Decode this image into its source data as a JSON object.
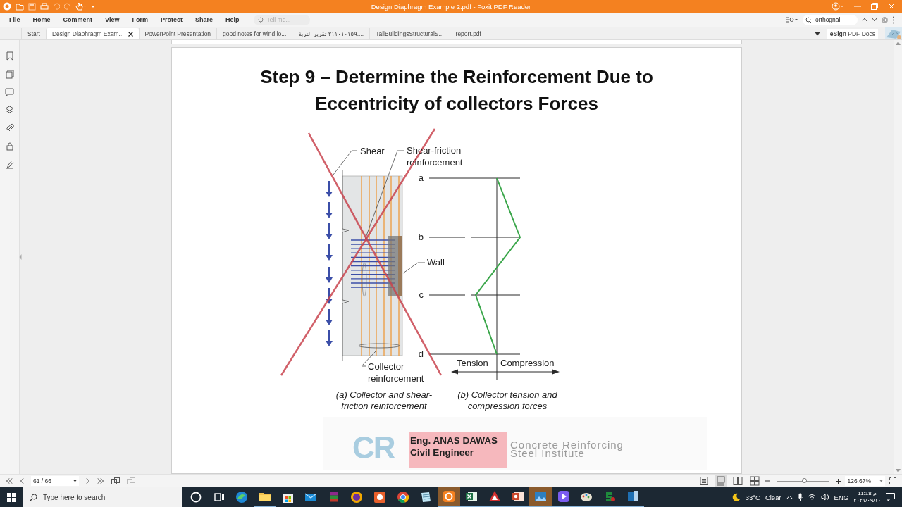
{
  "title_bar": {
    "title": "Design Diaphragm Example 2.pdf - Foxit PDF Reader"
  },
  "menu": [
    "File",
    "Home",
    "Comment",
    "View",
    "Form",
    "Protect",
    "Share",
    "Help"
  ],
  "tell_me": {
    "placeholder": "Tell me..."
  },
  "find": {
    "value": "orthognal"
  },
  "doc_tabs": [
    {
      "label": "Start",
      "selected": false
    },
    {
      "label": "Design Diaphragm Exam...",
      "selected": true
    },
    {
      "label": "PowerPoint Presentation",
      "selected": false
    },
    {
      "label": "good notes for wind lo...",
      "selected": false
    },
    {
      "label": "٢١١٠١٠١٥٩ تقرير التربة....",
      "selected": false
    },
    {
      "label": "TallBuildingsStructuralS...",
      "selected": false
    },
    {
      "label": "report.pdf",
      "selected": false
    }
  ],
  "esign": "**eSign** PDF Docs",
  "slide": {
    "title": "Step 9 – Determine the Reinforcement Due to Eccentricity of collectors Forces",
    "figure": {
      "labels": [
        {
          "lines": [
            "Shear"
          ]
        },
        {
          "lines": [
            "Shear-friction",
            "reinforcement"
          ]
        },
        {
          "lines": [
            "a"
          ]
        },
        {
          "lines": [
            "b"
          ]
        },
        {
          "lines": [
            "Wall"
          ]
        },
        {
          "lines": [
            "c"
          ]
        },
        {
          "lines": [
            "d"
          ]
        },
        {
          "lines": [
            "Collector",
            "reinforcement"
          ]
        },
        {
          "lines": [
            "Tension"
          ]
        },
        {
          "lines": [
            "Compression"
          ]
        }
      ],
      "captions": [
        {
          "lines": [
            "(a) Collector and shear-",
            "friction reinforcement"
          ]
        },
        {
          "lines": [
            "(b) Collector tension and",
            "compression forces"
          ]
        }
      ]
    },
    "credit": [
      "Eng. ANAS DAWAS",
      "Civil Engineer"
    ],
    "logo": {
      "mark": "CR",
      "lines": [
        "Concrete Reinforcing",
        "Steel Institute"
      ]
    }
  },
  "status_bar": {
    "page": "61 / 66",
    "view_modes": [
      {
        "kind": "single",
        "selected": false
      },
      {
        "kind": "continuous",
        "selected": true
      },
      {
        "kind": "facing",
        "selected": false
      },
      {
        "kind": "continuous-facing",
        "selected": false
      }
    ],
    "zoom_slider": {
      "level": 0.54
    },
    "zoom": "126.67%"
  },
  "taskbar": {
    "search_placeholder": "Type here to search",
    "apps": [
      {
        "kind": "cortana",
        "running": false,
        "selected": false
      },
      {
        "kind": "task-view",
        "running": false,
        "selected": false
      },
      {
        "kind": "edge",
        "running": false,
        "selected": false
      },
      {
        "kind": "folder",
        "running": true,
        "selected": false
      },
      {
        "kind": "store",
        "running": false,
        "selected": false
      },
      {
        "kind": "mail",
        "running": false,
        "selected": false
      },
      {
        "kind": "archive",
        "running": false,
        "selected": false
      },
      {
        "kind": "shield",
        "running": false,
        "selected": false
      },
      {
        "kind": "orange-app",
        "running": false,
        "selected": false
      },
      {
        "kind": "chrome",
        "running": false,
        "selected": false
      },
      {
        "kind": "notepad",
        "running": false,
        "selected": false
      },
      {
        "kind": "foxit",
        "running": true,
        "selected": true
      },
      {
        "kind": "excel",
        "running": true,
        "selected": false
      },
      {
        "kind": "acrobat",
        "running": true,
        "selected": false
      },
      {
        "kind": "powerpoint",
        "running": true,
        "selected": false
      },
      {
        "kind": "photos",
        "running": true,
        "selected": true
      },
      {
        "kind": "video",
        "running": true,
        "selected": false
      },
      {
        "kind": "paint",
        "running": true,
        "selected": false
      },
      {
        "kind": "green-app",
        "running": true,
        "selected": false
      },
      {
        "kind": "ebook",
        "running": true,
        "selected": false
      }
    ],
    "weather": {
      "temp": "33°C",
      "condition": "Clear"
    },
    "language": "ENG",
    "time": "11:18 م",
    "date": "٢٠٢١/٠٩/١٠"
  }
}
